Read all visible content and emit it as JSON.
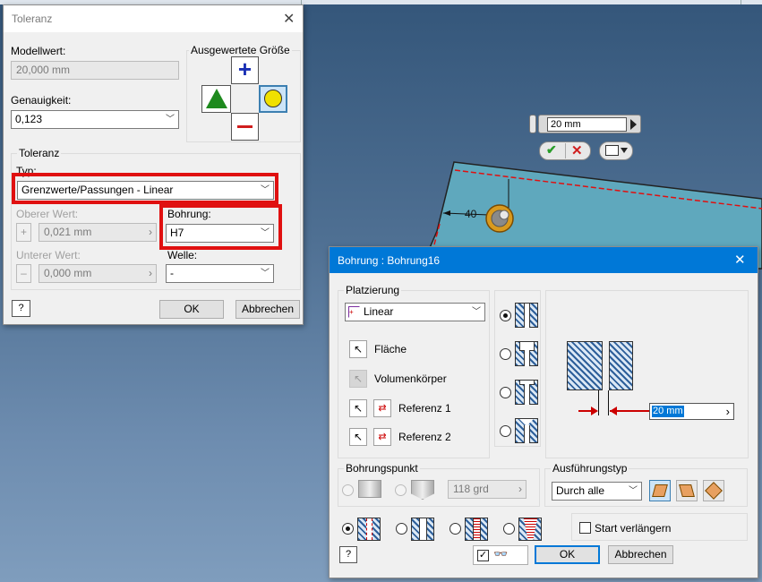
{
  "app": {
    "colors": {
      "accent": "#0078d7",
      "highlight": "#e01010",
      "part": "#5fa8bd"
    }
  },
  "viewport": {
    "dim_input": "20 mm",
    "dim_label": "40",
    "ok_icon": "checkmark-icon",
    "cancel_icon": "x-icon"
  },
  "toleranz": {
    "title": "Toleranz",
    "modellwert_label": "Modellwert:",
    "modellwert_value": "20,000 mm",
    "genauigkeit_label": "Genauigkeit:",
    "genauigkeit_value": "0,123",
    "ausgewertete_label": "Ausgewertete Größe",
    "group_label": "Toleranz",
    "typ_label": "Typ:",
    "typ_value": "Grenzwerte/Passungen - Linear",
    "oberer_label": "Oberer Wert:",
    "oberer_value": "0,021 mm",
    "bohrung_label": "Bohrung:",
    "bohrung_value": "H7",
    "unterer_label": "Unterer Wert:",
    "unterer_value": "0,000 mm",
    "welle_label": "Welle:",
    "welle_value": "-",
    "ok_label": "OK",
    "cancel_label": "Abbrechen"
  },
  "bohrung": {
    "title": "Bohrung : Bohrung16",
    "platzierung_label": "Platzierung",
    "placement_value": "Linear",
    "flaeche_label": "Fläche",
    "volumen_label": "Volumenkörper",
    "ref1_label": "Referenz 1",
    "ref2_label": "Referenz 2",
    "dim_value": "20 mm",
    "bohrungspunkt_label": "Bohrungspunkt",
    "angle_value": "118 grd",
    "ausfuehrung_label": "Ausführungstyp",
    "ausfuehrung_value": "Durch alle",
    "start_label": "Start verlängern",
    "ok_label": "OK",
    "cancel_label": "Abbrechen"
  }
}
